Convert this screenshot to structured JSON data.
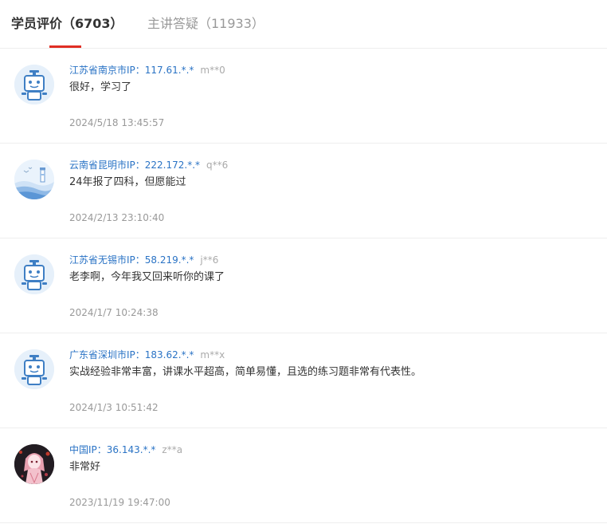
{
  "tabs": [
    {
      "label": "学员评价（6703）",
      "active": true
    },
    {
      "label": "主讲答疑（11933）",
      "active": false
    }
  ],
  "reviews": [
    {
      "avatar": "robot-avatar-icon",
      "location": "江苏省南京市IP：117.61.*.*",
      "user": "m**0",
      "comment": "很好，学习了",
      "time": "2024/5/18 13:45:57"
    },
    {
      "avatar": "lighthouse-avatar-icon",
      "location": "云南省昆明市IP：222.172.*.*",
      "user": "q**6",
      "comment": "24年报了四科，但愿能过",
      "time": "2024/2/13 23:10:40"
    },
    {
      "avatar": "robot-avatar-icon",
      "location": "江苏省无锡市IP：58.219.*.*",
      "user": "j**6",
      "comment": "老李啊，今年我又回来听你的课了",
      "time": "2024/1/7 10:24:38"
    },
    {
      "avatar": "robot-avatar-icon",
      "location": "广东省深圳市IP：183.62.*.*",
      "user": "m**x",
      "comment": "实战经验非常丰富，讲课水平超高，简单易懂，且选的练习题非常有代表性。",
      "time": "2024/1/3 10:51:42"
    },
    {
      "avatar": "anime-girl-avatar-icon",
      "location": "中国IP：36.143.*.*",
      "user": "z**a",
      "comment": "非常好",
      "time": "2023/11/19 19:47:00"
    }
  ],
  "colors": {
    "accent": "#e02e24",
    "location_link": "#2a73c5",
    "muted": "#999999"
  }
}
